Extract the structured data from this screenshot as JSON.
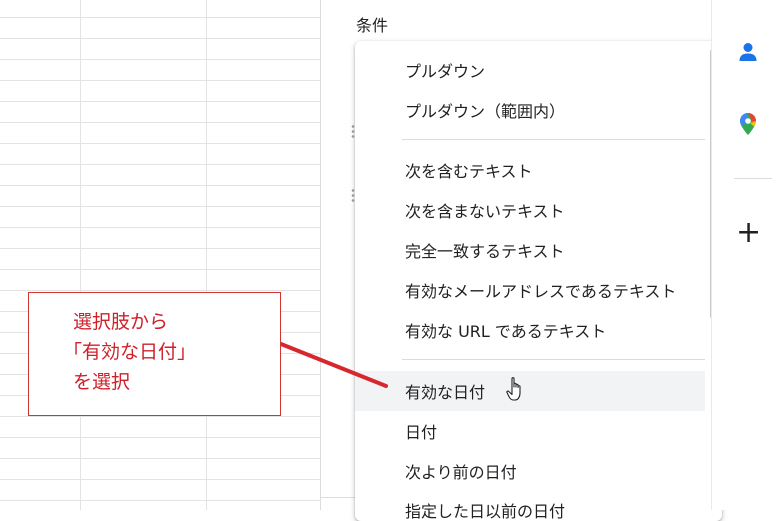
{
  "panel": {
    "title": "条件"
  },
  "menu": {
    "items": [
      {
        "label": "プルダウン"
      },
      {
        "label": "プルダウン（範囲内）"
      },
      {
        "label": "次を含むテキスト"
      },
      {
        "label": "次を含まないテキスト"
      },
      {
        "label": "完全一致するテキスト"
      },
      {
        "label": "有効なメールアドレスであるテキスト"
      },
      {
        "label": "有効な URL であるテキスト"
      },
      {
        "label": "有効な日付"
      },
      {
        "label": "日付"
      },
      {
        "label": "次より前の日付"
      },
      {
        "label": "指定した日以前の日付"
      }
    ],
    "highlighted_item": "有効な日付"
  },
  "rail": {
    "icons": [
      "contacts-icon",
      "maps-icon",
      "add-icon"
    ],
    "add_label": "+"
  },
  "annotation": {
    "lines": [
      "選択肢から",
      "「有効な日付」",
      "を選択"
    ]
  },
  "colors": {
    "annotation": "#d0202a",
    "hover_background": "#f1f3f4",
    "contacts": "#1a73e8",
    "maps_red": "#ea4335",
    "maps_green": "#34a853",
    "maps_yellow": "#fbbc04",
    "maps_blue": "#4285f4"
  }
}
